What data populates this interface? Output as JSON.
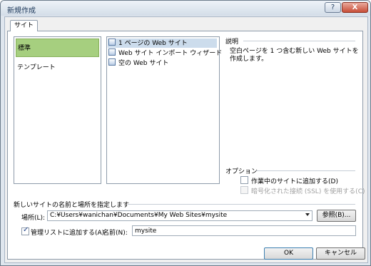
{
  "window": {
    "title": "新規作成",
    "help_label": "?",
    "close_label": "X"
  },
  "tabs": [
    {
      "label": "サイト"
    }
  ],
  "categories": [
    {
      "label": "標準",
      "selected": true
    },
    {
      "label": "テンプレート",
      "selected": false
    }
  ],
  "templates": [
    {
      "label": "1 ページの Web サイト",
      "icon": "page-icon"
    },
    {
      "label": "Web サイト インポート ウィザード",
      "icon": "import-wizard-icon"
    },
    {
      "label": "空の Web サイト",
      "icon": "empty-site-icon"
    }
  ],
  "description": {
    "heading": "説明",
    "text_line1": "空白ページを 1 つ含む新しい Web サイトを",
    "text_line2": "作成します。"
  },
  "options": {
    "heading": "オプション",
    "add_to_current": {
      "label": "作業中のサイトに追加する(D)",
      "checked": false
    },
    "ssl": {
      "label": "暗号化された接続 (SSL) を使用する(C)",
      "checked": false,
      "disabled": true
    }
  },
  "location_section": {
    "heading": "新しいサイトの名前と場所を指定します",
    "location_label": "場所(L):",
    "location_value": "C:¥Users¥wanichan¥Documents¥My Web Sites¥mysite",
    "browse_label": "参照(B)...",
    "add_to_list": {
      "label": "管理リストに追加する(A)",
      "checked": true
    },
    "name_label": "名前(N):",
    "name_value": "mysite"
  },
  "footer": {
    "ok_label": "OK",
    "cancel_label": "キャンセル"
  }
}
